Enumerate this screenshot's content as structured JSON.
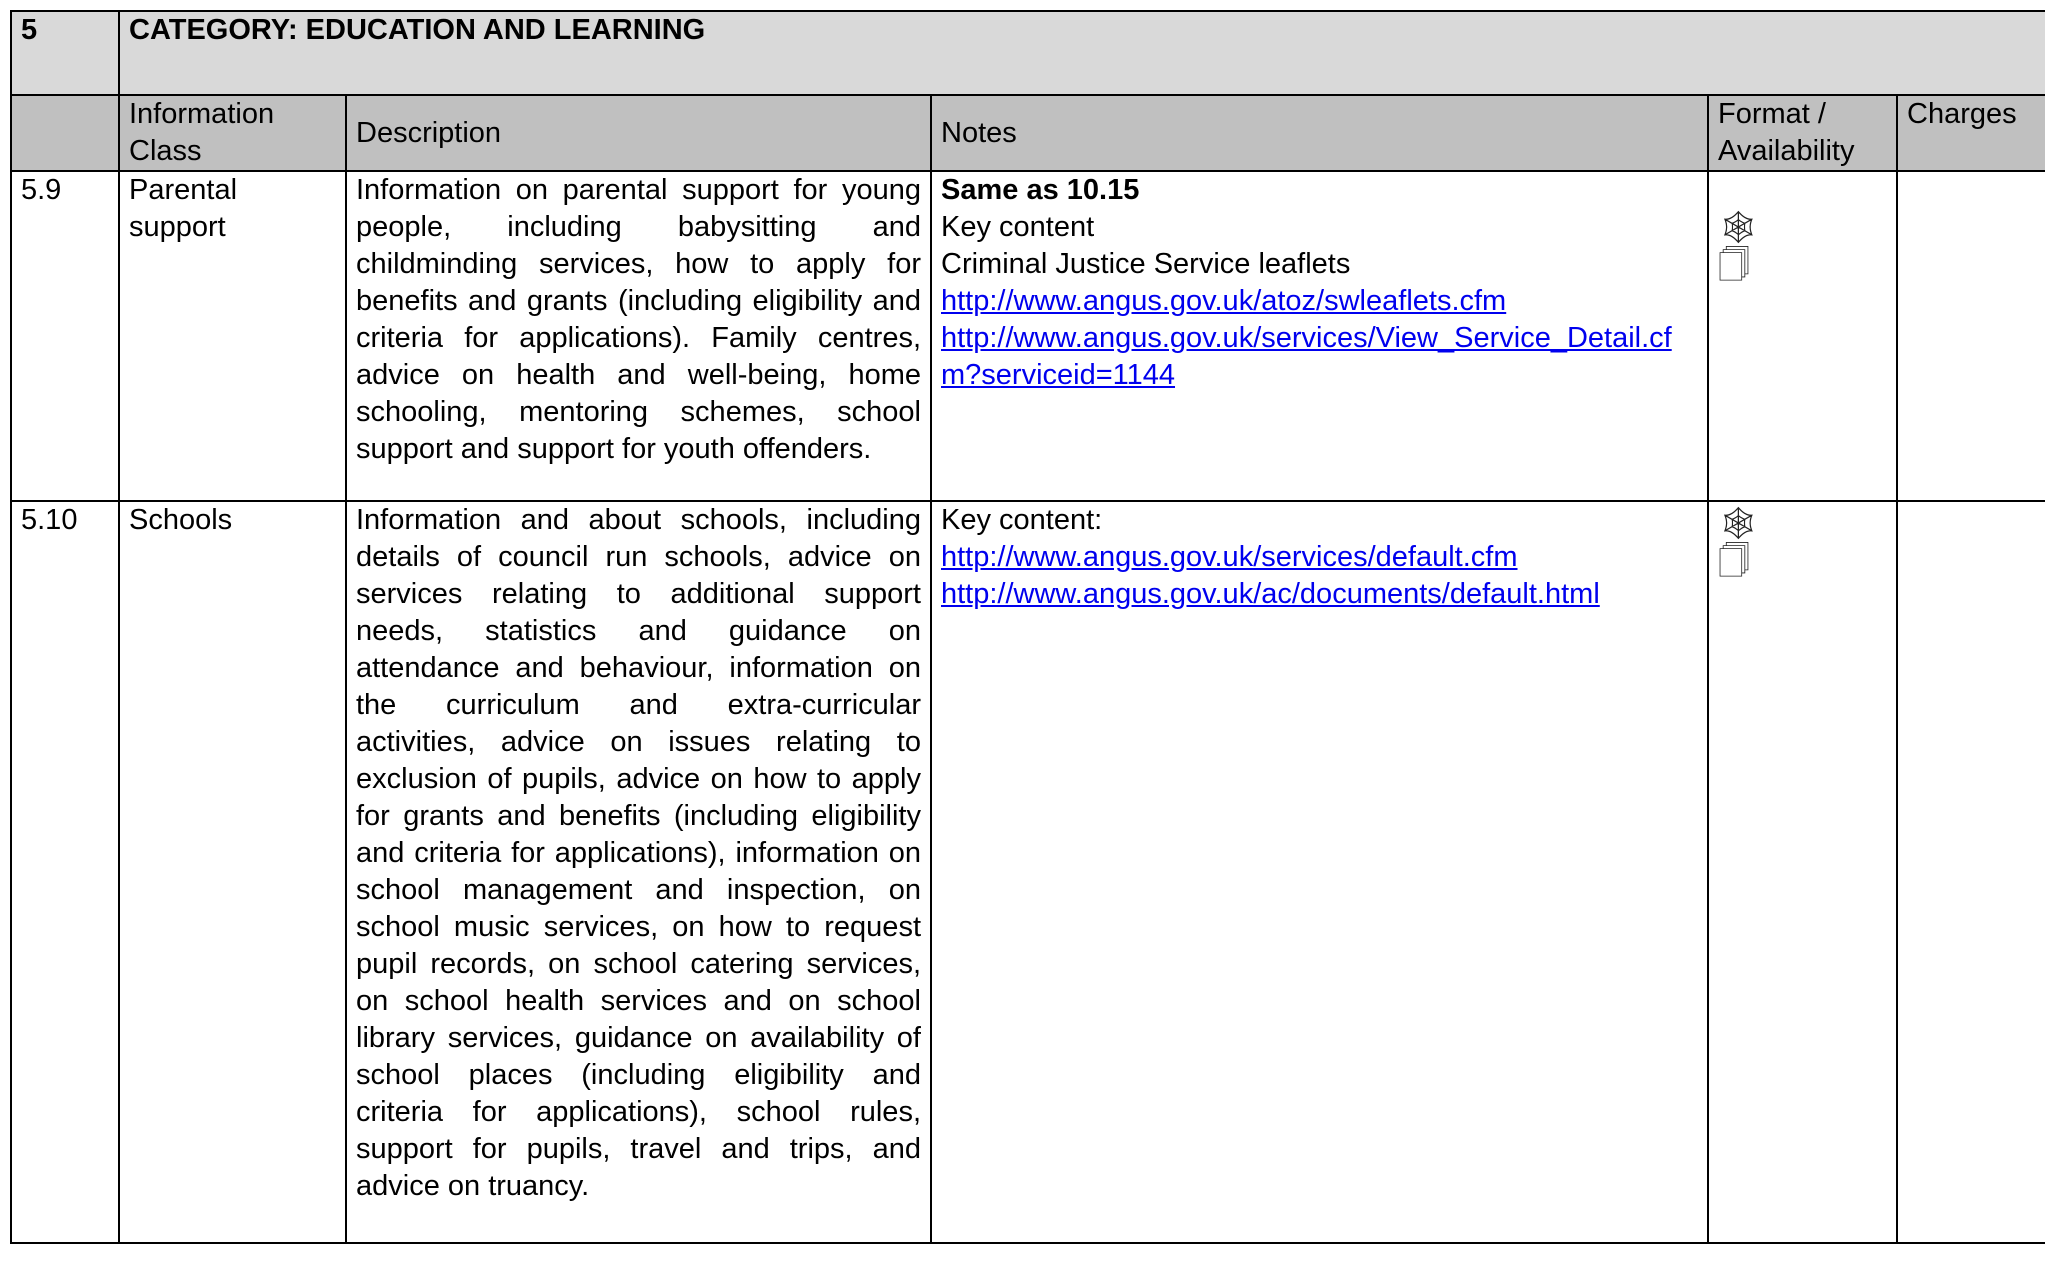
{
  "category": {
    "number": "5",
    "title": "CATEGORY: EDUCATION AND LEARNING"
  },
  "columns": {
    "info_class_line1": "Information",
    "info_class_line2": "Class",
    "description": "Description",
    "notes": "Notes",
    "format_line1": "Format /",
    "format_line2": "Availability",
    "charges": "Charges"
  },
  "rows": [
    {
      "id": "5.9",
      "class_line1": "Parental",
      "class_line2": "support",
      "description": "Information on parental support for young people, including babysitting and childminding services, how to apply for benefits and grants (including eligibility and criteria for applications). Family centres, advice on health and well-being, home schooling, mentoring schemes, school support and support for youth offenders.",
      "notes": {
        "bold": "Same as 10.15",
        "line1": "Key content",
        "line2": "Criminal Justice Service leaflets",
        "link1": "http://www.angus.gov.uk/atoz/swleaflets.cfm",
        "link2": "http://www.angus.gov.uk/services/View_Service_Detail.cfm?serviceid=1144"
      },
      "format_icons": [
        "web-icon",
        "document-icon"
      ],
      "charges": ""
    },
    {
      "id": "5.10",
      "class_line1": "Schools",
      "description": "Information and about schools, including details of council run schools, advice on services relating to additional support needs, statistics and guidance on attendance and behaviour, information on the curriculum and extra-curricular activities, advice on issues relating to exclusion of pupils, advice on how to apply for grants and benefits (including eligibility and criteria for applications), information on school management and inspection, on school music services, on how to request pupil records, on school catering services, on school health services and on school library services, guidance on availability of school places (including eligibility and criteria for applications), school rules, support for pupils, travel and trips, and advice on truancy.",
      "notes": {
        "line1": "Key content:",
        "link1": "http://www.angus.gov.uk/services/default.cfm",
        "link2": "http://www.angus.gov.uk/ac/documents/default.html"
      },
      "format_icons": [
        "web-icon",
        "document-icon"
      ],
      "charges": ""
    }
  ]
}
